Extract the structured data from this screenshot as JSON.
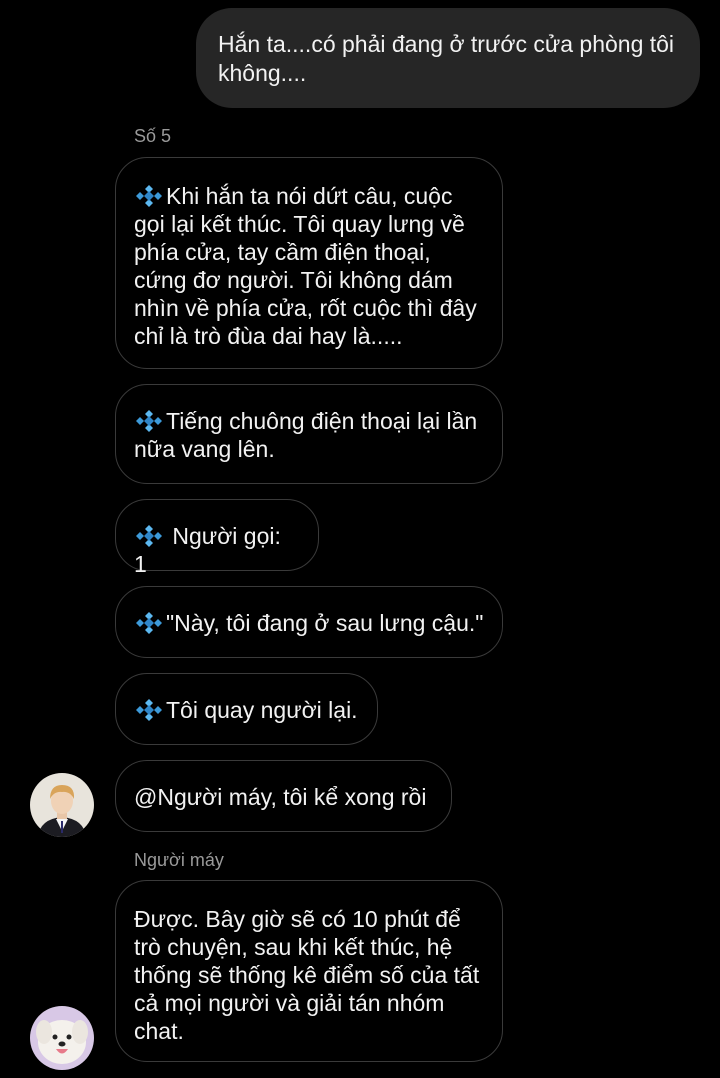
{
  "outgoing": {
    "text": "Hắn ta....có phải đang ở trước cửa phòng tôi không...."
  },
  "sender_1": "Số 5",
  "messages_1": [
    {
      "text": "Khi hắn ta nói dứt câu, cuộc gọi lại kết thúc. Tôi quay lưng về phía cửa, tay cầm điện thoại, cứng đơ người. Tôi không dám nhìn về phía cửa, rốt cuộc thì đây chỉ là trò đùa dai hay là....."
    },
    {
      "text": "Tiếng chuông điện thoại lại lần nữa vang lên."
    },
    {
      "text": " Người gọi: 1"
    },
    {
      "text": "\"Này, tôi đang ở sau lưng cậu.\""
    },
    {
      "text": "Tôi quay người lại."
    },
    {
      "text": "@Người máy, tôi kể xong rồi"
    }
  ],
  "sender_2": "Người máy",
  "messages_2": [
    {
      "text": "Được. Bây giờ sẽ có 10 phút để trò chuyện, sau khi kết thúc, hệ thống sẽ thống kê điểm số của tất cả mọi người và giải tán nhóm chat."
    }
  ],
  "icons": {
    "bullet": "blue-diamond-icon",
    "avatar_1": "boy-avatar",
    "avatar_2": "dog-avatar"
  },
  "colors": {
    "background": "#000000",
    "outgoing_bubble": "#262626",
    "incoming_border": "#3a3a3a",
    "sender_name": "#9a9a9a",
    "diamond": "#4aa8e6"
  }
}
